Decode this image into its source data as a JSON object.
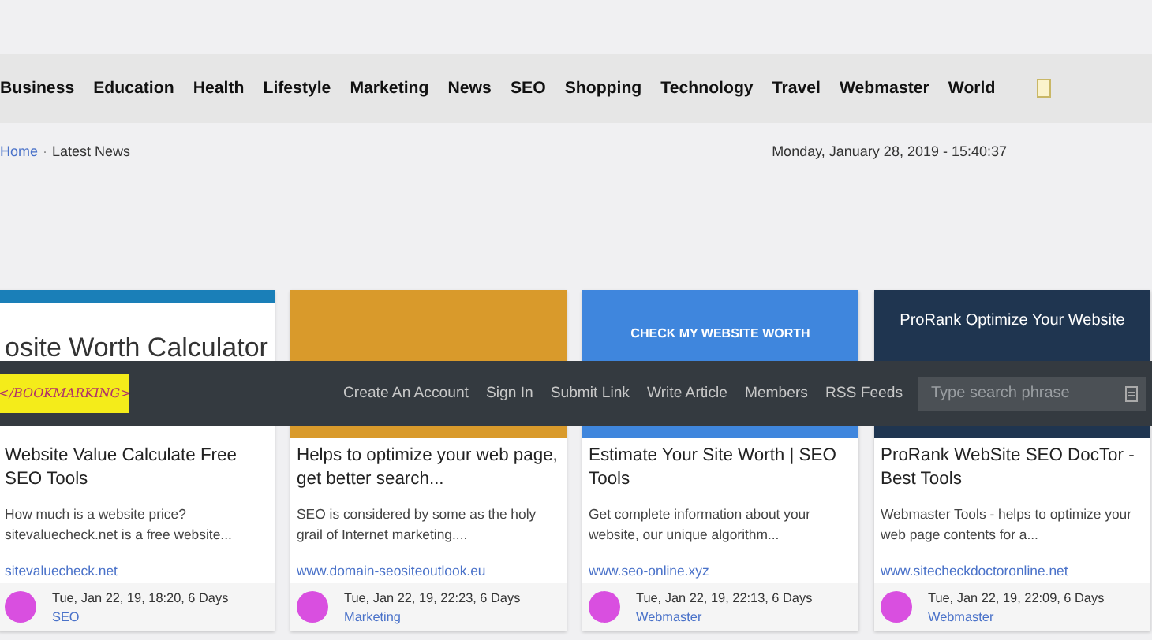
{
  "categories": [
    {
      "label": "Business"
    },
    {
      "label": "Education"
    },
    {
      "label": "Health"
    },
    {
      "label": "Lifestyle"
    },
    {
      "label": "Marketing"
    },
    {
      "label": "News"
    },
    {
      "label": "SEO"
    },
    {
      "label": "Shopping"
    },
    {
      "label": "Technology"
    },
    {
      "label": "Travel"
    },
    {
      "label": "Webmaster"
    },
    {
      "label": "World"
    }
  ],
  "breadcrumb": {
    "home": "Home",
    "separator": "·",
    "current": "Latest News"
  },
  "datetime": "Monday, January 28, 2019 - 15:40:37",
  "navbar": {
    "logo_text": "</BOOKMARKING>",
    "links": [
      "Create An Account",
      "Sign In",
      "Submit Link",
      "Write Article",
      "Members",
      "RSS Feeds"
    ],
    "search": {
      "placeholder": "Type search phrase"
    }
  },
  "cards": [
    {
      "color": "#ffffff",
      "thumb_heading": "osite Worth Calculator",
      "title": "Website Value Calculate Free SEO Tools",
      "description": "How much is a website price? sitevaluecheck.net is a free website...",
      "link": "sitevaluecheck.net",
      "date": "Tue, Jan 22, 19, 18:20, 6 Days",
      "category": "SEO"
    },
    {
      "color": "#d99a2b",
      "title": "Helps to optimize your web page, get better search...",
      "description": "SEO is considered by some as the holy grail of Internet marketing....",
      "link": "www.domain-seositeoutlook.eu",
      "date": "Tue, Jan 22, 19, 22:23, 6 Days",
      "category": "Marketing"
    },
    {
      "color": "#3f86dd",
      "thumb_heading": "CHECK MY WEBSITE WORTH",
      "title": "Estimate Your Site Worth | SEO Tools",
      "description": "Get complete information about your website, our unique algorithm...",
      "link": "www.seo-online.xyz",
      "date": "Tue, Jan 22, 19, 22:13, 6 Days",
      "category": "Webmaster"
    },
    {
      "color": "#1f3550",
      "thumb_heading": "ProRank Optimize Your Website",
      "title": "ProRank WebSite SEO DocTor - Best Tools",
      "description": "Webmaster Tools - helps to optimize your web page contents for a...",
      "link": "www.sitecheckdoctoronline.net",
      "date": "Tue, Jan 22, 19, 22:09, 6 Days",
      "category": "Webmaster"
    }
  ]
}
